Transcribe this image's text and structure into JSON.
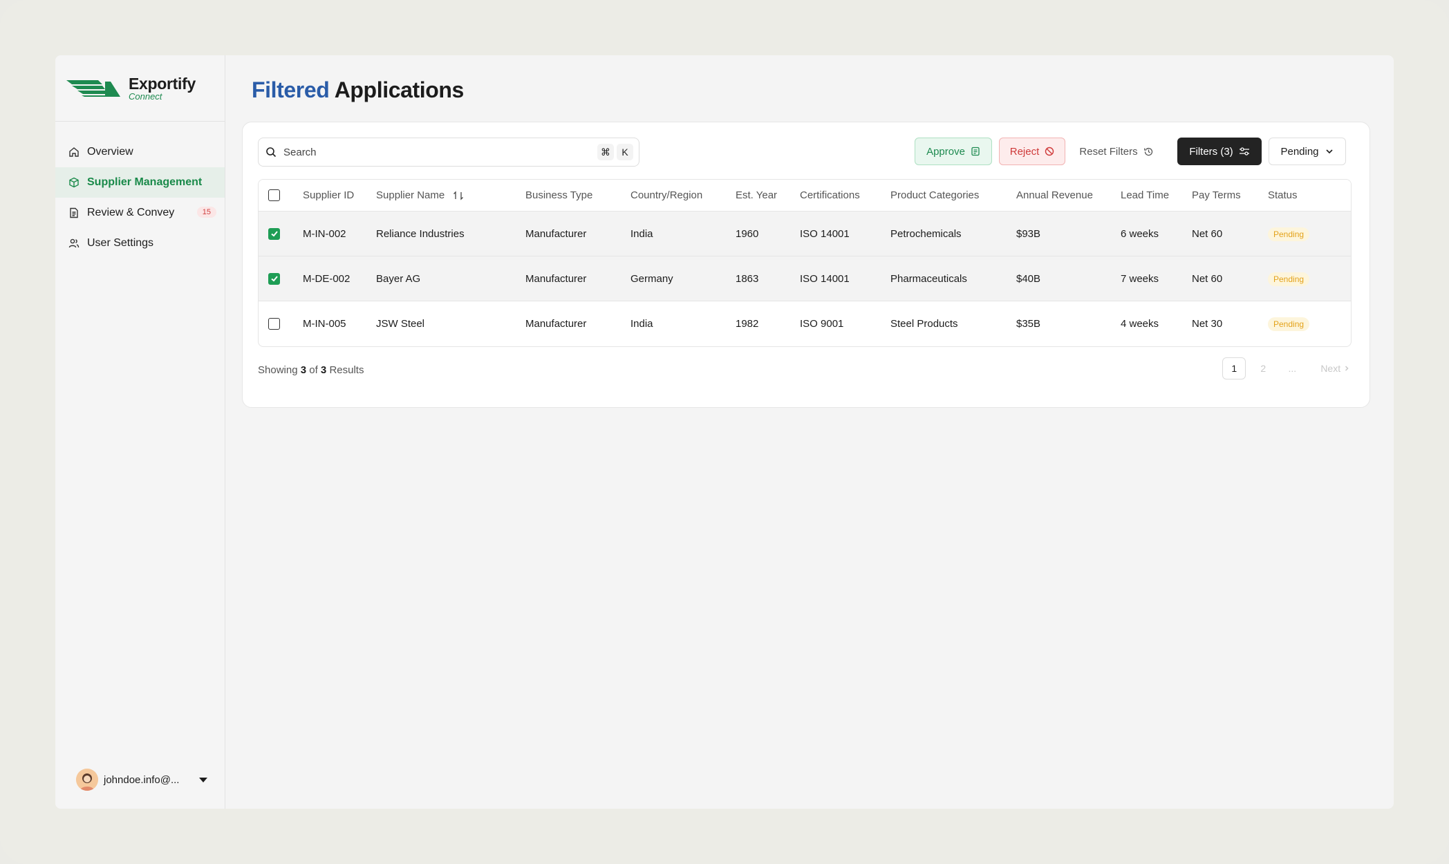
{
  "brand": {
    "name": "Exportify",
    "sub": "Connect",
    "color": "#1e8a50"
  },
  "sidebar": {
    "items": [
      {
        "label": "Overview",
        "icon": "home-icon",
        "active": false
      },
      {
        "label": "Supplier Management",
        "icon": "package-icon",
        "active": true
      },
      {
        "label": "Review & Convey",
        "icon": "document-icon",
        "active": false,
        "badge": "15"
      },
      {
        "label": "User Settings",
        "icon": "users-icon",
        "active": false
      }
    ],
    "user": {
      "email": "johndoe.info@..."
    }
  },
  "page": {
    "title_highlight": "Filtered",
    "title_rest": "Applications"
  },
  "toolbar": {
    "search_placeholder": "Search",
    "shortcut_cmd": "⌘",
    "shortcut_key": "K",
    "approve_label": "Approve",
    "reject_label": "Reject",
    "reset_label": "Reset Filters",
    "filters_label": "Filters (3)",
    "status_select": "Pending"
  },
  "table": {
    "columns": [
      "Supplier ID",
      "Supplier Name",
      "Business Type",
      "Country/Region",
      "Est. Year",
      "Certifications",
      "Product Categories",
      "Annual Revenue",
      "Lead Time",
      "Pay Terms",
      "Status"
    ],
    "rows": [
      {
        "checked": true,
        "cells": [
          "M-IN-002",
          "Reliance Industries",
          "Manufacturer",
          "India",
          "1960",
          "ISO 14001",
          "Petrochemicals",
          "$93B",
          "6 weeks",
          "Net 60",
          "Pending"
        ]
      },
      {
        "checked": true,
        "cells": [
          "M-DE-002",
          "Bayer AG",
          "Manufacturer",
          "Germany",
          "1863",
          "ISO 14001",
          "Pharmaceuticals",
          "$40B",
          "7 weeks",
          "Net 60",
          "Pending"
        ]
      },
      {
        "checked": false,
        "cells": [
          "M-IN-005",
          "JSW Steel",
          "Manufacturer",
          "India",
          "1982",
          "ISO 9001",
          "Steel Products",
          "$35B",
          "4 weeks",
          "Net 30",
          "Pending"
        ]
      }
    ]
  },
  "footer": {
    "showing_prefix": "Showing",
    "showing_count": "3",
    "showing_of": "of",
    "showing_total": "3",
    "showing_suffix": "Results",
    "pages": [
      "1",
      "2",
      "..."
    ],
    "next_label": "Next"
  }
}
